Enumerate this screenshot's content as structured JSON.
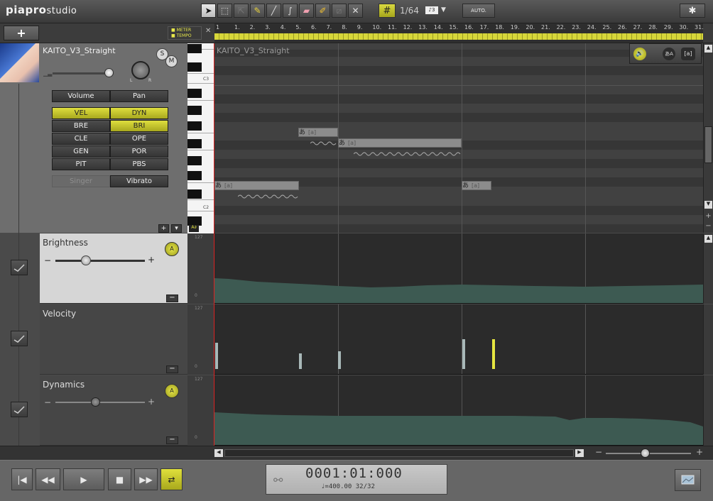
{
  "app": {
    "logo_main": "piapro",
    "logo_sub": "studio"
  },
  "toolbar": {
    "tools": [
      {
        "name": "select-arrow",
        "glyph": "➤"
      },
      {
        "name": "range-select",
        "glyph": "⬚"
      },
      {
        "name": "move",
        "glyph": "⇱"
      },
      {
        "name": "pencil",
        "glyph": "✎"
      },
      {
        "name": "line",
        "glyph": "╱"
      },
      {
        "name": "curve",
        "glyph": "∫"
      },
      {
        "name": "eraser",
        "glyph": "▰"
      },
      {
        "name": "marker",
        "glyph": "✐"
      },
      {
        "name": "knife",
        "glyph": "⧄"
      },
      {
        "name": "mute",
        "glyph": "✕"
      }
    ],
    "grid_glyph": "#",
    "quantize": "1/64",
    "quantize_icon": "♪3",
    "dropdown": "▼",
    "auto": "AUTO.",
    "gear": "✱"
  },
  "secondbar": {
    "add": "+",
    "meter": "■ METER",
    "tempo": "■ TEMPO",
    "collapse": "✕"
  },
  "ruler": {
    "start": "1",
    "labels": [
      "1.",
      "2.",
      "3.",
      "4.",
      "5.",
      "6.",
      "7.",
      "8.",
      "9.",
      "10.",
      "11.",
      "12.",
      "13.",
      "14.",
      "15.",
      "16.",
      "17.",
      "18.",
      "19.",
      "20.",
      "21.",
      "22.",
      "23.",
      "24.",
      "25.",
      "26.",
      "27.",
      "28.",
      "29.",
      "30.",
      "31."
    ]
  },
  "track": {
    "singer": "KAITO_V3_Straight",
    "solo": "S",
    "mute": "M",
    "pan_l": "L",
    "pan_r": "R",
    "volume": "Volume",
    "pan": "Pan",
    "params": [
      [
        "VEL",
        "DYN"
      ],
      [
        "BRE",
        "BRI"
      ],
      [
        "CLE",
        "OPE"
      ],
      [
        "GEN",
        "POR"
      ],
      [
        "PIT",
        "PBS"
      ]
    ],
    "singer_btn": "Singer",
    "vibrato_btn": "Vibrato",
    "add": "+",
    "menu": "▾"
  },
  "piano": {
    "c3": "C3",
    "c2": "C2",
    "ab": "A∂"
  },
  "roll": {
    "track_name": "KAITO_V3_Straight",
    "speaker": "🔊",
    "lang": "あA",
    "phoneme": "[a]"
  },
  "notes": [
    {
      "lyric": "あ",
      "phoneme": "[a]"
    },
    {
      "lyric": "あ",
      "phoneme": "[a]"
    },
    {
      "lyric": "あ",
      "phoneme": "[a]"
    },
    {
      "lyric": "あ",
      "phoneme": "[a]"
    }
  ],
  "lanes": [
    {
      "title": "Brightness",
      "max": "127",
      "min": "0",
      "auto": "A",
      "minus": "−",
      "plus": "+",
      "collapse": "−"
    },
    {
      "title": "Velocity",
      "max": "127",
      "min": "0",
      "collapse": "−"
    },
    {
      "title": "Dynamics",
      "max": "127",
      "min": "0",
      "auto": "A",
      "minus": "−",
      "plus": "+",
      "collapse": "−"
    }
  ],
  "zoom": {
    "minus": "−",
    "plus": "+"
  },
  "transport": {
    "first": "|◀",
    "rewind": "◀◀",
    "play": "▶",
    "stop": "■",
    "forward": "▶▶",
    "loop": "⇄",
    "time": "0001:01:000",
    "tempo": "♩=400.00  32/32",
    "link": "⚯"
  },
  "colors": {
    "accent": "#c8c830",
    "note": "#8c8c8c",
    "curve": "#3d5a52",
    "playhead": "#d22222"
  }
}
